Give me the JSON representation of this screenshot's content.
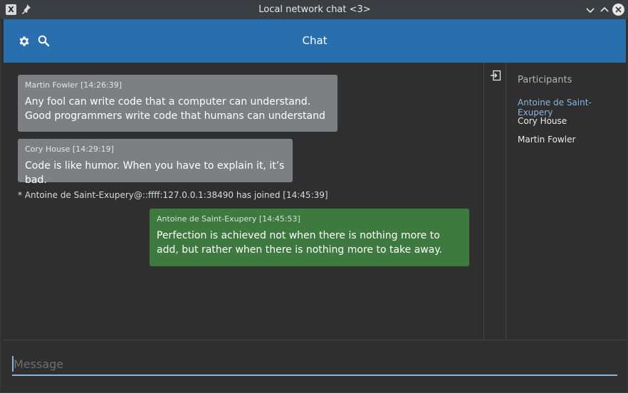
{
  "window": {
    "title": "Local network chat <3>",
    "app_icon": "X"
  },
  "appbar": {
    "title": "Chat",
    "icons": [
      "gear-icon",
      "search-icon"
    ],
    "color": "#2a6fad"
  },
  "messages": [
    {
      "author_line": "Martin Fowler [14:26:39]",
      "text": "Any fool can write code that a computer can understand. Good programmers write code that humans can understand",
      "style": "gray"
    },
    {
      "author_line": "Cory House [14:29:19]",
      "text": "Code is like humor. When you have to explain it, it’s bad.",
      "style": "gray"
    },
    {
      "author_line": "Antoine de Saint-Exupery [14:45:53]",
      "text": "Perfection is achieved not when there is nothing more to add, but rather when there is nothing more to take away.",
      "style": "green"
    }
  ],
  "join_notice": "* Antoine de Saint-Exupery@::ffff:127.0.0.1:38490 has joined [14:45:39]",
  "participants": {
    "heading": "Participants",
    "items": [
      "Antoine de Saint-Exupery",
      "Cory House",
      "Martin Fowler"
    ],
    "self_color": "#8ab4de"
  },
  "composer": {
    "placeholder": "Message",
    "value": ""
  }
}
